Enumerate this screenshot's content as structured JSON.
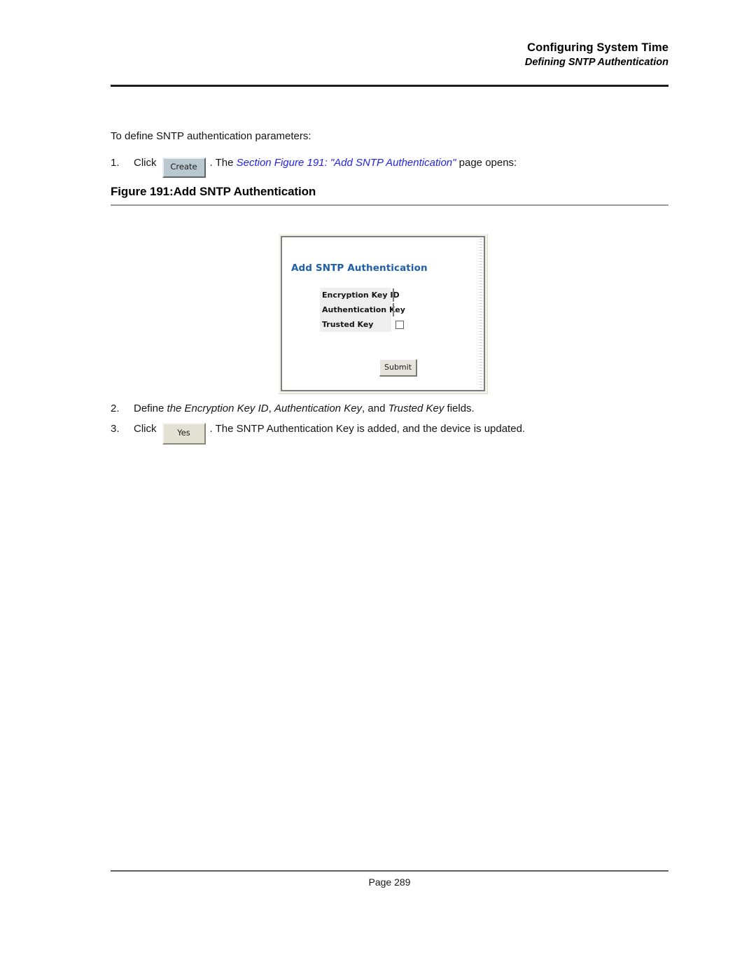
{
  "header": {
    "title": "Configuring System Time",
    "subtitle": "Defining SNTP Authentication"
  },
  "body": {
    "intro": "To define SNTP authentication parameters:",
    "steps": [
      {
        "number": "1.",
        "text_before": "Click",
        "button_label": "Create",
        "text_mid": ". The",
        "link_text": "Section Figure 191: \"Add SNTP Authentication\"",
        "text_after": "page opens:"
      },
      {
        "number": "2.",
        "text_before": "Define",
        "italic_1": "the Encryption Key ID",
        "sep_1": ",",
        "italic_2": "Authentication Key",
        "sep_2": ", and",
        "italic_3": "Trusted Key",
        "text_after": "fields."
      },
      {
        "number": "3.",
        "text_before": "Click",
        "button_label": "Yes",
        "text_after": ". The SNTP Authentication Key is added, and the device is updated."
      }
    ]
  },
  "figure": {
    "caption": "Figure 191:Add SNTP Authentication",
    "dialog": {
      "title": "Add SNTP Authentication",
      "title_color": "#1f5fa9",
      "fields": [
        {
          "label": "Encryption Key ID",
          "type": "text",
          "value": ""
        },
        {
          "label": "Authentication Key",
          "type": "text",
          "value": ""
        },
        {
          "label": "Trusted Key",
          "type": "checkbox",
          "checked": false
        }
      ],
      "submit_label": "Submit"
    }
  },
  "footer": {
    "page_label": "Page 289"
  }
}
